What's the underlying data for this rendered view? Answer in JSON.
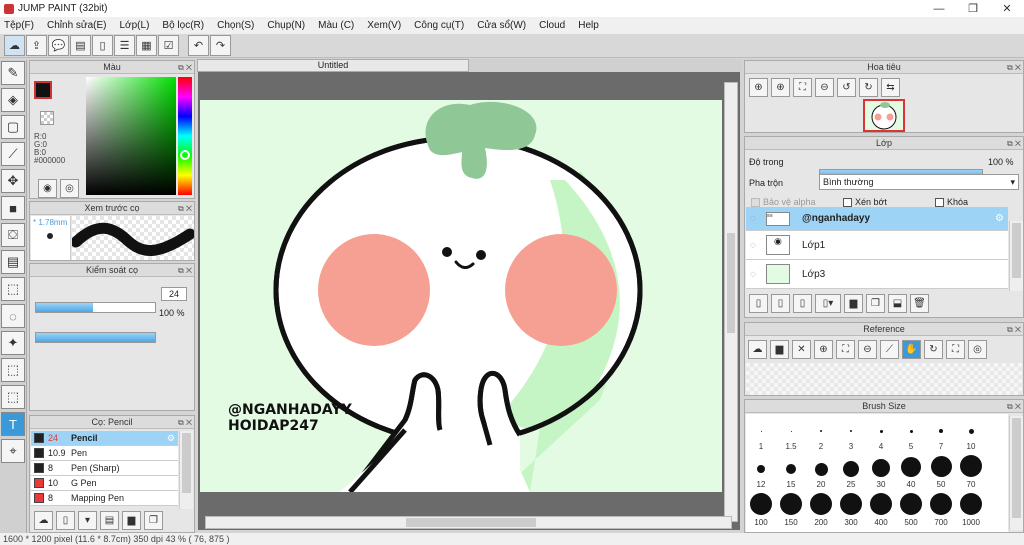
{
  "window": {
    "title": "JUMP PAINT (32bit)",
    "minimize": "—",
    "restore": "❐",
    "close": "✕"
  },
  "menu": [
    "Tệp(F)",
    "Chỉnh sửa(E)",
    "Lớp(L)",
    "Bộ lọc(R)",
    "Chọn(S)",
    "Chụp(N)",
    "Màu (C)",
    "Xem(V)",
    "Công cụ(T)",
    "Cửa sổ(W)",
    "Cloud",
    "Help"
  ],
  "color_panel": {
    "title": "Màu",
    "r": "R:0",
    "g": "G:0",
    "b": "B:0",
    "hex": "#000000"
  },
  "preview_panel": {
    "title": "Xem trước cọ",
    "size": "* 1.78mm"
  },
  "control_panel": {
    "title": "Kiểm soát cọ",
    "size_value": "24",
    "opacity_value": "100 %",
    "size_fraction": 0.48,
    "opacity_fraction": 1.0
  },
  "brush_list": {
    "title": "Cọ: Pencil",
    "items": [
      {
        "size": "24",
        "name": "Pencil",
        "color": "#222222"
      },
      {
        "size": "10.9",
        "name": "Pen",
        "color": "#222222"
      },
      {
        "size": "8",
        "name": "Pen (Sharp)",
        "color": "#222222"
      },
      {
        "size": "10",
        "name": "G Pen",
        "color": "#e83a3a"
      },
      {
        "size": "8",
        "name": "Mapping Pen",
        "color": "#e83a3a"
      }
    ]
  },
  "document": {
    "tab": "Untitled",
    "text_line1": "@NGANHADAYY",
    "text_line2": "HOIDAP247"
  },
  "navigator": {
    "title": "Hoa tiêu"
  },
  "layer_panel": {
    "title": "Lớp",
    "opacity_label": "Độ trong",
    "opacity_value": "100 %",
    "opacity_fraction": 1.0,
    "blend_label": "Pha trộn",
    "blend_value": "Bình thường",
    "protect_alpha": "Bảo vệ alpha",
    "clip": "Xén bớt",
    "lock": "Khóa",
    "layers": [
      {
        "name": "@nganhadayy"
      },
      {
        "name": "Lớp1"
      },
      {
        "name": "Lớp3"
      }
    ]
  },
  "reference_panel": {
    "title": "Reference"
  },
  "brush_size_panel": {
    "title": "Brush Size",
    "rows": [
      [
        "1",
        "1.5",
        "2",
        "3",
        "4",
        "5",
        "7",
        "10"
      ],
      [
        "12",
        "15",
        "20",
        "25",
        "30",
        "40",
        "50",
        "70"
      ],
      [
        "100",
        "150",
        "200",
        "300",
        "400",
        "500",
        "700",
        "1000"
      ]
    ]
  },
  "status": "1600 * 1200 pixel   (11.6 * 8.7cm)  350 dpi  43 %  ( 76, 875 )"
}
